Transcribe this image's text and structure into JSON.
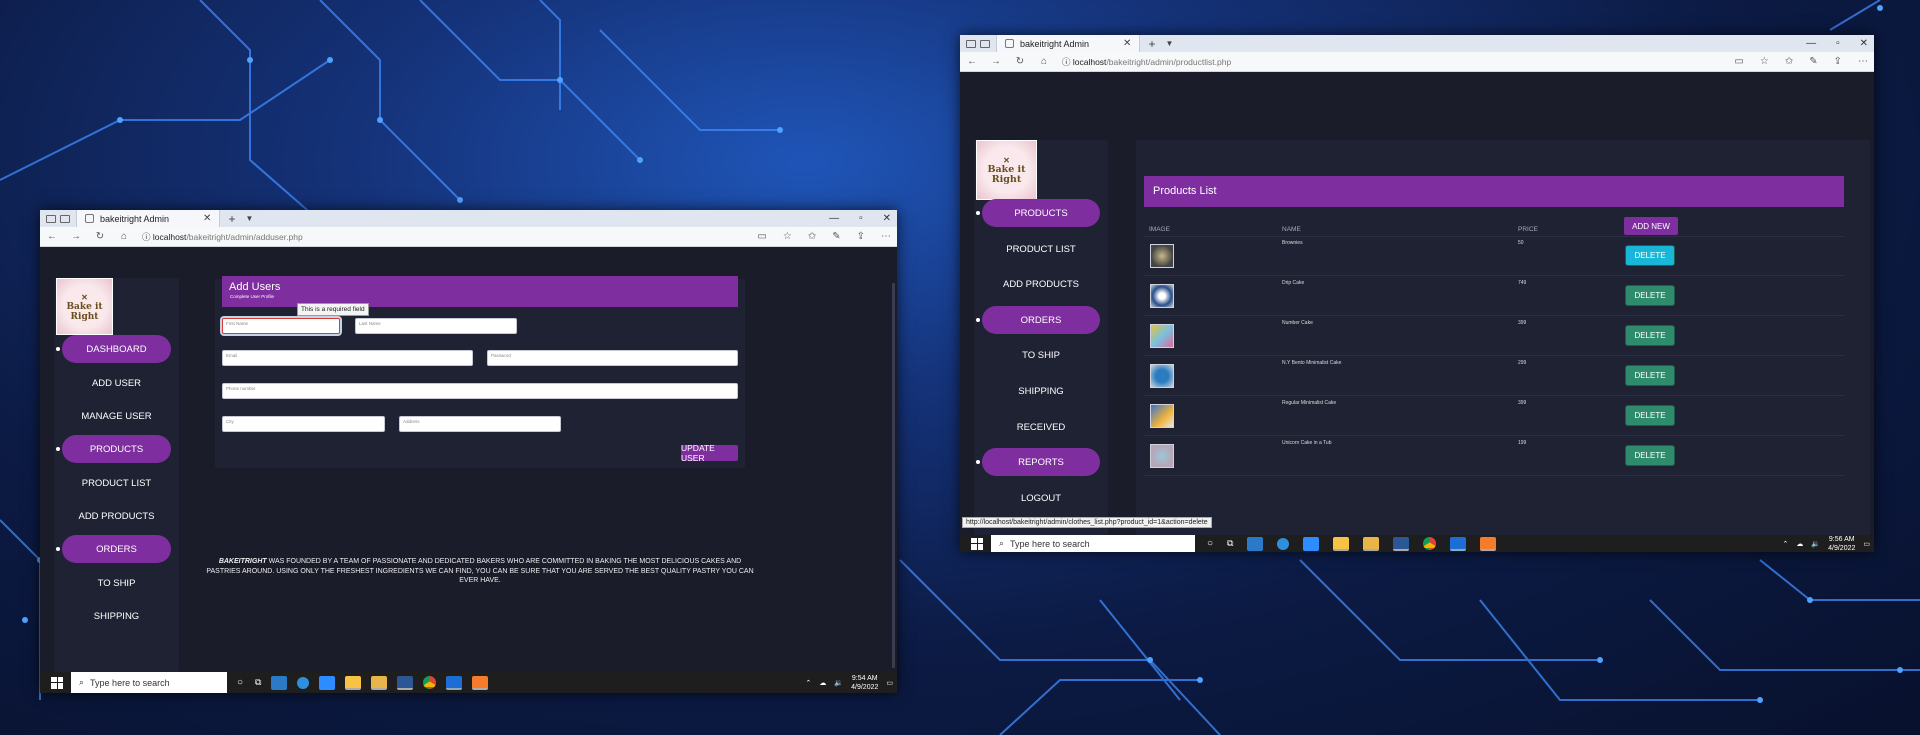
{
  "window1": {
    "tab_title": "bakeitright Admin",
    "url_host": "localhost",
    "url_path": "/bakeitright/admin/adduser.php",
    "logo_text": "Bake it Right",
    "nav": [
      "DASHBOARD",
      "ADD USER",
      "MANAGE USER",
      "PRODUCTS",
      "PRODUCT LIST",
      "ADD PRODUCTS",
      "ORDERS",
      "TO SHIP",
      "SHIPPING"
    ],
    "panel_title": "Add Users",
    "panel_subtitle": "Complete User Profile",
    "tooltip": "This is a required field",
    "fields": {
      "first_name": "First Name",
      "last_name": "Last Name",
      "email": "Email",
      "password": "Password",
      "phone": "Phone number",
      "city": "City",
      "address": "Address"
    },
    "update_button": "UPDATE USER",
    "footer_brand": "BAKEITRIGHT",
    "footer_text": " WAS FOUNDED BY A TEAM OF PASSIONATE AND DEDICATED BAKERS WHO ARE COMMITTED IN BAKING THE MOST DELICIOUS CAKES AND PASTRIES AROUND. USING ONLY THE FRESHEST INGREDIENTS WE CAN FIND, YOU CAN BE SURE THAT YOU ARE SERVED THE BEST QUALITY PASTRY YOU CAN EVER HAVE.",
    "taskbar": {
      "search": "Type here to search",
      "time": "9:54 AM",
      "date": "4/9/2022"
    }
  },
  "window2": {
    "tab_title": "bakeitright Admin",
    "url_host": "localhost",
    "url_path": "/bakeitright/admin/productlist.php",
    "logo_text": "Bake it Right",
    "nav": [
      "PRODUCTS",
      "PRODUCT LIST",
      "ADD PRODUCTS",
      "ORDERS",
      "TO SHIP",
      "SHIPPING",
      "RECEIVED",
      "REPORTS",
      "LOGOUT"
    ],
    "panel_title": "Products List",
    "columns": [
      "IMAGE",
      "NAME",
      "PRICE"
    ],
    "add_new": "ADD NEW",
    "delete_label": "DELETE",
    "products": [
      {
        "name": "Brownies",
        "price": "50"
      },
      {
        "name": "Drip Cake",
        "price": "749"
      },
      {
        "name": "Number Cake",
        "price": "399"
      },
      {
        "name": "N.Y Bento Minimalist Cake",
        "price": "299"
      },
      {
        "name": "Regular Minimalist Cake",
        "price": "399"
      },
      {
        "name": "Unicorn Cake in a Tub",
        "price": "199"
      }
    ],
    "status_url": "http://localhost/bakeitright/admin/clothes_list.php?product_id=1&action=delete",
    "taskbar": {
      "search": "Type here to search",
      "time": "9:56 AM",
      "date": "4/9/2022"
    }
  },
  "colors": {
    "accent": "#7e2e9e",
    "delete": "#2e8c6c",
    "delete_hover": "#18b7d8"
  }
}
